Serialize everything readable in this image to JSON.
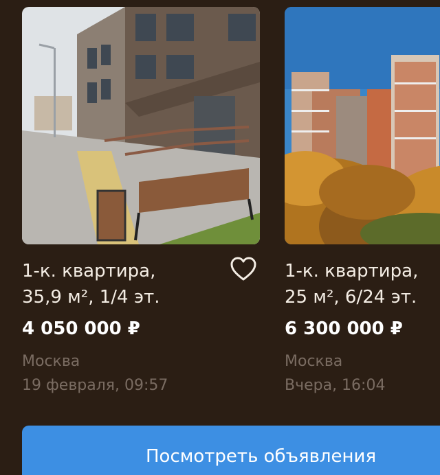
{
  "listings": [
    {
      "title_line1": "1-к. квартира,",
      "title_line2": "35,9 м², 1/4 эт.",
      "price": "4 050 000 ₽",
      "city": "Москва",
      "date": "19 февраля, 09:57",
      "favorite": false
    },
    {
      "title_line1": "1-к. квартира,",
      "title_line2": "25 м², 6/24 эт.",
      "price": "6 300 000 ₽",
      "city": "Москва",
      "date": "Вчера, 16:04",
      "favorite": false
    }
  ],
  "cta": {
    "label": "Посмотреть объявления",
    "color": "#3d8fe3"
  },
  "colors": {
    "background": "#2b1e14",
    "title_text": "#f4ede4",
    "meta_text": "#7a6c62"
  },
  "icons": {
    "favorite": "heart-outline-icon"
  }
}
